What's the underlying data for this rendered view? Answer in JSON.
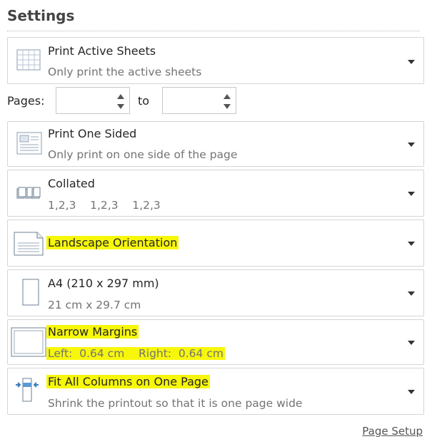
{
  "header": {
    "title": "Settings"
  },
  "print_what": {
    "title": "Print Active Sheets",
    "subtitle": "Only print the active sheets",
    "icon": "sheets-icon"
  },
  "pages": {
    "label": "Pages:",
    "to_label": "to",
    "from_value": "",
    "to_value": ""
  },
  "sides": {
    "title": "Print One Sided",
    "subtitle": "Only print on one side of the page",
    "icon": "one-sided-icon"
  },
  "collation": {
    "title": "Collated",
    "subtitle": "1,2,3    1,2,3    1,2,3",
    "icon": "collated-icon"
  },
  "orientation": {
    "title": "Landscape Orientation",
    "icon": "landscape-icon"
  },
  "paper_size": {
    "title": "A4 (210 x 297 mm)",
    "subtitle": "21 cm x 29.7 cm",
    "icon": "portrait-page-icon"
  },
  "margins": {
    "title": "Narrow Margins",
    "subtitle": "Left:  0.64 cm    Right:  0.64 cm",
    "icon": "margins-icon"
  },
  "scaling": {
    "title": "Fit All Columns on One Page",
    "subtitle": "Shrink the printout so that it is one page wide",
    "icon": "fit-columns-icon"
  },
  "footer": {
    "page_setup": "Page Setup"
  },
  "colors": {
    "highlight": "#f7f70a",
    "border": "#d5d5d5",
    "subtext": "#737373"
  }
}
